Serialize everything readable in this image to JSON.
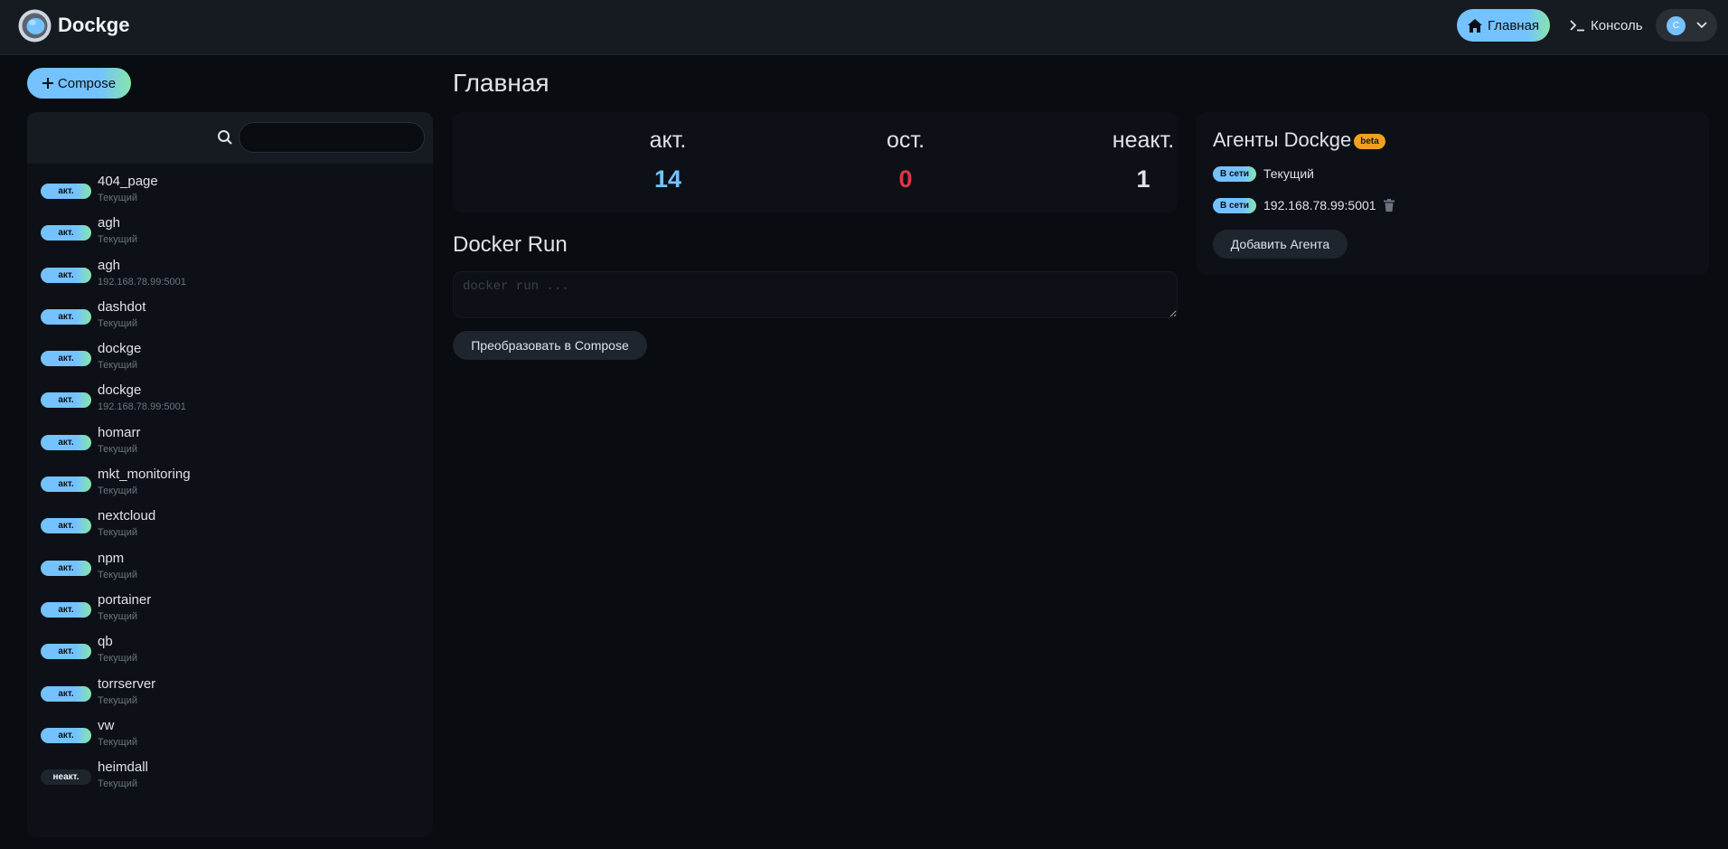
{
  "header": {
    "app_title": "Dockge",
    "nav_home_label": "Главная",
    "nav_console_label": "Консоль",
    "avatar_initial": "C"
  },
  "compose_button_label": "Compose",
  "search": {
    "value": "",
    "placeholder": ""
  },
  "stacks": [
    {
      "name": "404_page",
      "agent": "Текущий",
      "status": "акт."
    },
    {
      "name": "agh",
      "agent": "Текущий",
      "status": "акт."
    },
    {
      "name": "agh",
      "agent": "192.168.78.99:5001",
      "status": "акт."
    },
    {
      "name": "dashdot",
      "agent": "Текущий",
      "status": "акт."
    },
    {
      "name": "dockge",
      "agent": "Текущий",
      "status": "акт."
    },
    {
      "name": "dockge",
      "agent": "192.168.78.99:5001",
      "status": "акт."
    },
    {
      "name": "homarr",
      "agent": "Текущий",
      "status": "акт."
    },
    {
      "name": "mkt_monitoring",
      "agent": "Текущий",
      "status": "акт."
    },
    {
      "name": "nextcloud",
      "agent": "Текущий",
      "status": "акт."
    },
    {
      "name": "npm",
      "agent": "Текущий",
      "status": "акт."
    },
    {
      "name": "portainer",
      "agent": "Текущий",
      "status": "акт."
    },
    {
      "name": "qb",
      "agent": "Текущий",
      "status": "акт."
    },
    {
      "name": "torrserver",
      "agent": "Текущий",
      "status": "акт."
    },
    {
      "name": "vw",
      "agent": "Текущий",
      "status": "акт."
    },
    {
      "name": "heimdall",
      "agent": "Текущий",
      "status": "неакт."
    }
  ],
  "main": {
    "page_title": "Главная",
    "stats": {
      "active_label": "акт.",
      "active_value": "14",
      "exited_label": "ост.",
      "exited_value": "0",
      "inactive_label": "неакт.",
      "inactive_value": "1"
    },
    "docker_run_title": "Docker Run",
    "docker_run_placeholder": "docker run ...",
    "convert_button_label": "Преобразовать в Compose"
  },
  "agents": {
    "title": "Агенты Dockge",
    "beta_label": "beta",
    "online_label": "В сети",
    "list": [
      "Текущий",
      "192.168.78.99:5001"
    ],
    "add_agent_label": "Добавить Агента"
  },
  "colors": {
    "accent": "#74c2ff",
    "accent_end": "#86e6a9",
    "active_value": "#74c2ff",
    "exited_value": "#dc3545",
    "inactive_value": "#dfe3e8",
    "beta": "#f0a020"
  }
}
